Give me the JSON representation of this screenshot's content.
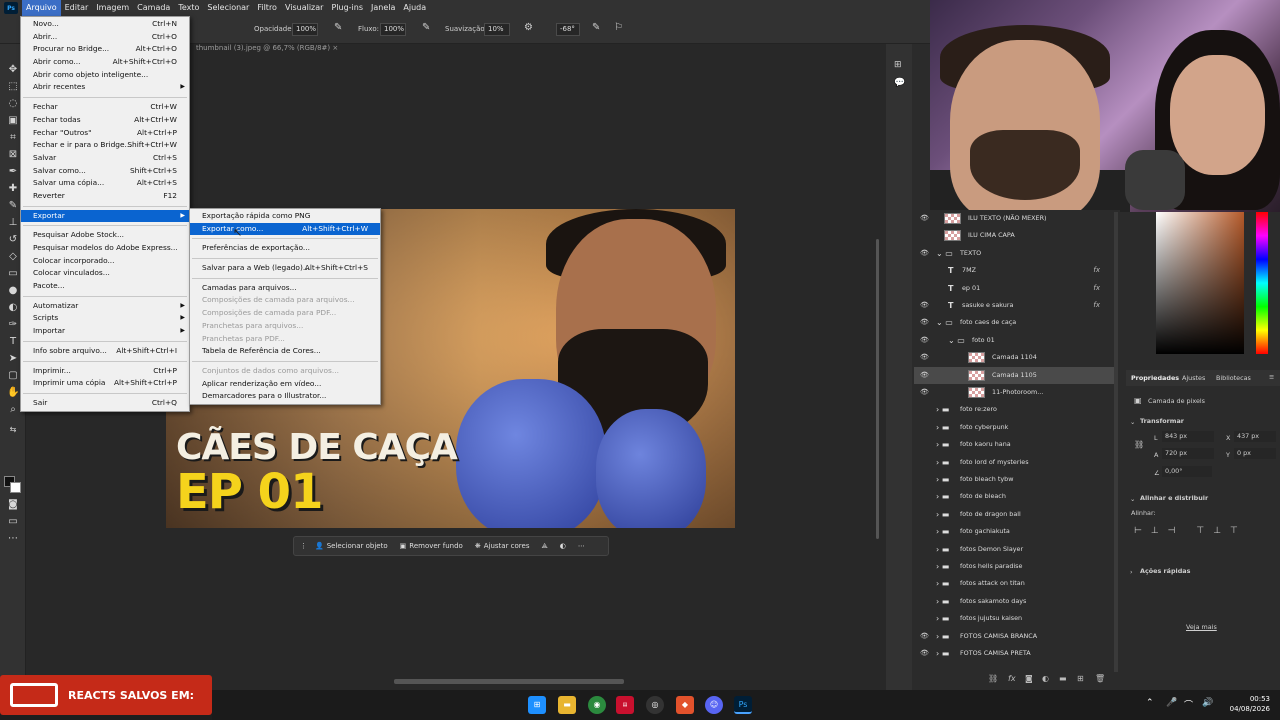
{
  "menubar": {
    "logo": "Ps",
    "items": [
      "Arquivo",
      "Editar",
      "Imagem",
      "Camada",
      "Texto",
      "Selecionar",
      "Filtro",
      "Visualizar",
      "Plug-ins",
      "Janela",
      "Ajuda"
    ]
  },
  "options": {
    "opacity_label": "Opacidade:",
    "opacity_value": "100%",
    "flow_label": "Fluxo:",
    "flow_value": "100%",
    "smoothing_label": "Suavização:",
    "smoothing_value": "10%",
    "angle_value": "-68°"
  },
  "document": {
    "tab": "thumbnail (3).jpeg @ 66,7% (RGB/8#)"
  },
  "thumbnail": {
    "title_line1": "CÃES DE CAÇA",
    "title_line2": "EP 01"
  },
  "context_bar": {
    "select_subject": "Selecionar objeto",
    "remove_bg": "Remover fundo",
    "adjust_colors": "Ajustar cores"
  },
  "file_menu": [
    {
      "label": "Novo...",
      "shortcut": "Ctrl+N"
    },
    {
      "label": "Abrir...",
      "shortcut": "Ctrl+O"
    },
    {
      "label": "Procurar no Bridge...",
      "shortcut": "Alt+Ctrl+O"
    },
    {
      "label": "Abrir como...",
      "shortcut": "Alt+Shift+Ctrl+O"
    },
    {
      "label": "Abrir como objeto inteligente...",
      "shortcut": ""
    },
    {
      "label": "Abrir recentes",
      "shortcut": "",
      "submenu": true
    },
    {
      "sep": true
    },
    {
      "label": "Fechar",
      "shortcut": "Ctrl+W"
    },
    {
      "label": "Fechar todas",
      "shortcut": "Alt+Ctrl+W"
    },
    {
      "label": "Fechar \"Outros\"",
      "shortcut": "Alt+Ctrl+P"
    },
    {
      "label": "Fechar e ir para o Bridge...",
      "shortcut": "Shift+Ctrl+W"
    },
    {
      "label": "Salvar",
      "shortcut": "Ctrl+S"
    },
    {
      "label": "Salvar como...",
      "shortcut": "Shift+Ctrl+S"
    },
    {
      "label": "Salvar uma cópia...",
      "shortcut": "Alt+Ctrl+S"
    },
    {
      "label": "Reverter",
      "shortcut": "F12"
    },
    {
      "sep": true
    },
    {
      "label": "Exportar",
      "shortcut": "",
      "submenu": true,
      "highlight": true
    },
    {
      "sep": true
    },
    {
      "label": "Pesquisar Adobe Stock...",
      "shortcut": ""
    },
    {
      "label": "Pesquisar modelos do Adobe Express...",
      "shortcut": ""
    },
    {
      "label": "Colocar incorporado...",
      "shortcut": ""
    },
    {
      "label": "Colocar vinculados...",
      "shortcut": ""
    },
    {
      "label": "Pacote...",
      "shortcut": ""
    },
    {
      "sep": true
    },
    {
      "label": "Automatizar",
      "shortcut": "",
      "submenu": true
    },
    {
      "label": "Scripts",
      "shortcut": "",
      "submenu": true
    },
    {
      "label": "Importar",
      "shortcut": "",
      "submenu": true
    },
    {
      "sep": true
    },
    {
      "label": "Info sobre arquivo...",
      "shortcut": "Alt+Shift+Ctrl+I"
    },
    {
      "sep": true
    },
    {
      "label": "Imprimir...",
      "shortcut": "Ctrl+P"
    },
    {
      "label": "Imprimir uma cópia",
      "shortcut": "Alt+Shift+Ctrl+P"
    },
    {
      "sep": true
    },
    {
      "label": "Sair",
      "shortcut": "Ctrl+Q"
    }
  ],
  "export_menu": [
    {
      "label": "Exportação rápida como PNG",
      "shortcut": ""
    },
    {
      "label": "Exportar como...",
      "shortcut": "Alt+Shift+Ctrl+W",
      "highlight": true
    },
    {
      "sep": true
    },
    {
      "label": "Preferências de exportação...",
      "shortcut": ""
    },
    {
      "sep": true
    },
    {
      "label": "Salvar para a Web (legado)...",
      "shortcut": "Alt+Shift+Ctrl+S"
    },
    {
      "sep": true
    },
    {
      "label": "Camadas para arquivos...",
      "shortcut": ""
    },
    {
      "label": "Composições de camada para arquivos...",
      "shortcut": "",
      "disabled": true
    },
    {
      "label": "Composições de camada para PDF...",
      "shortcut": "",
      "disabled": true
    },
    {
      "label": "Pranchetas para arquivos...",
      "shortcut": "",
      "disabled": true
    },
    {
      "label": "Pranchetas para PDF...",
      "shortcut": "",
      "disabled": true
    },
    {
      "label": "Tabela de Referência de Cores...",
      "shortcut": ""
    },
    {
      "sep": true
    },
    {
      "label": "Conjuntos de dados como arquivos...",
      "shortcut": "",
      "disabled": true
    },
    {
      "label": "Aplicar renderização em vídeo...",
      "shortcut": ""
    },
    {
      "label": "Demarcadores para o Illustrator...",
      "shortcut": ""
    }
  ],
  "layers": [
    {
      "name": "ILU TEXTO (NÃO MEXER)",
      "type": "thumb",
      "indent": 0,
      "eye": true
    },
    {
      "name": "ILU CIMA CAPA",
      "type": "thumb",
      "indent": 0,
      "eye": false
    },
    {
      "name": "TEXTO",
      "type": "folder-open",
      "indent": 0,
      "eye": true
    },
    {
      "name": "7MZ",
      "type": "text",
      "indent": 1,
      "eye": false,
      "fx": true
    },
    {
      "name": "ep 01",
      "type": "text",
      "indent": 1,
      "eye": false,
      "fx": true
    },
    {
      "name": "sasuke e sakura",
      "type": "text",
      "indent": 1,
      "eye": true,
      "fx": true
    },
    {
      "name": "foto caes de caça",
      "type": "folder-open",
      "indent": 0,
      "eye": true
    },
    {
      "name": "foto 01",
      "type": "folder-open",
      "indent": 1,
      "eye": true
    },
    {
      "name": "Camada 1104",
      "type": "thumb",
      "indent": 2,
      "eye": true
    },
    {
      "name": "Camada 1105",
      "type": "thumb",
      "indent": 2,
      "eye": true,
      "selected": true
    },
    {
      "name": "11-Photoroom...",
      "type": "thumb",
      "indent": 2,
      "eye": true
    },
    {
      "name": "foto re:zero",
      "type": "folder",
      "indent": 0,
      "eye": false
    },
    {
      "name": "foto cyberpunk",
      "type": "folder",
      "indent": 0,
      "eye": false
    },
    {
      "name": "foto kaoru hana",
      "type": "folder",
      "indent": 0,
      "eye": false
    },
    {
      "name": "foto lord of mysteries",
      "type": "folder",
      "indent": 0,
      "eye": false
    },
    {
      "name": "foto bleach tybw",
      "type": "folder",
      "indent": 0,
      "eye": false
    },
    {
      "name": "foto de bleach",
      "type": "folder",
      "indent": 0,
      "eye": false
    },
    {
      "name": "foto de dragon ball",
      "type": "folder",
      "indent": 0,
      "eye": false
    },
    {
      "name": "foto gachiakuta",
      "type": "folder",
      "indent": 0,
      "eye": false
    },
    {
      "name": "fotos Demon Slayer",
      "type": "folder",
      "indent": 0,
      "eye": false
    },
    {
      "name": "fotos hells paradise",
      "type": "folder",
      "indent": 0,
      "eye": false
    },
    {
      "name": "fotos  attack on titan",
      "type": "folder",
      "indent": 0,
      "eye": false
    },
    {
      "name": "fotos sakamoto days",
      "type": "folder",
      "indent": 0,
      "eye": false
    },
    {
      "name": "fotos jujutsu kaisen",
      "type": "folder",
      "indent": 0,
      "eye": false
    },
    {
      "name": "FOTOS CAMISA BRANCA",
      "type": "folder",
      "indent": 0,
      "eye": true
    },
    {
      "name": "FOTOS CAMISA PRETA",
      "type": "folder",
      "indent": 0,
      "eye": true
    }
  ],
  "properties": {
    "tabs": [
      "Propriedades",
      "Ajustes",
      "Bibliotecas"
    ],
    "layer_type": "Camada de pixels",
    "transform_label": "Transformar",
    "w_label": "L",
    "w_value": "843 px",
    "h_label": "A",
    "h_value": "720 px",
    "x_label": "X",
    "x_value": "437 px",
    "y_label": "Y",
    "y_value": "0 px",
    "angle_value": "0,00°",
    "align_label": "Alinhar e distribuir",
    "align_sub": "Alinhar:",
    "quick_actions": "Ações rápidas",
    "see_more": "Veja mais"
  },
  "overlay": {
    "reacts_text": "REACTS SALVOS EM:"
  },
  "taskbar": {
    "time": "00:53",
    "date": "04/08/2026"
  }
}
